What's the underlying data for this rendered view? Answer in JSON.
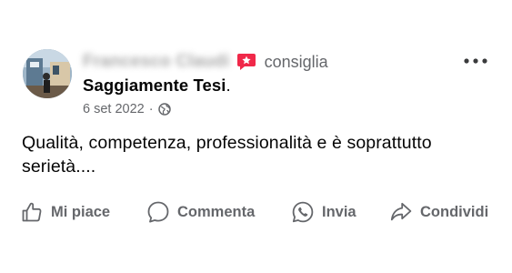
{
  "post": {
    "author_name_blurred": "Francesco Claudi",
    "recommends_label": "consiglia",
    "page_name": "Saggiamente Tesi",
    "page_name_suffix": ".",
    "date": "6 set 2022",
    "meta_separator": "·",
    "audience_icon": "globe-icon",
    "text": "Qualità, competenza, professionalità e è soprattutto serietà...."
  },
  "actions": {
    "like_label": "Mi piace",
    "comment_label": "Commenta",
    "send_label": "Invia",
    "share_label": "Condividi"
  },
  "colors": {
    "recommend_badge": "#f02849",
    "secondary_text": "#65676b",
    "primary_text": "#050505"
  }
}
